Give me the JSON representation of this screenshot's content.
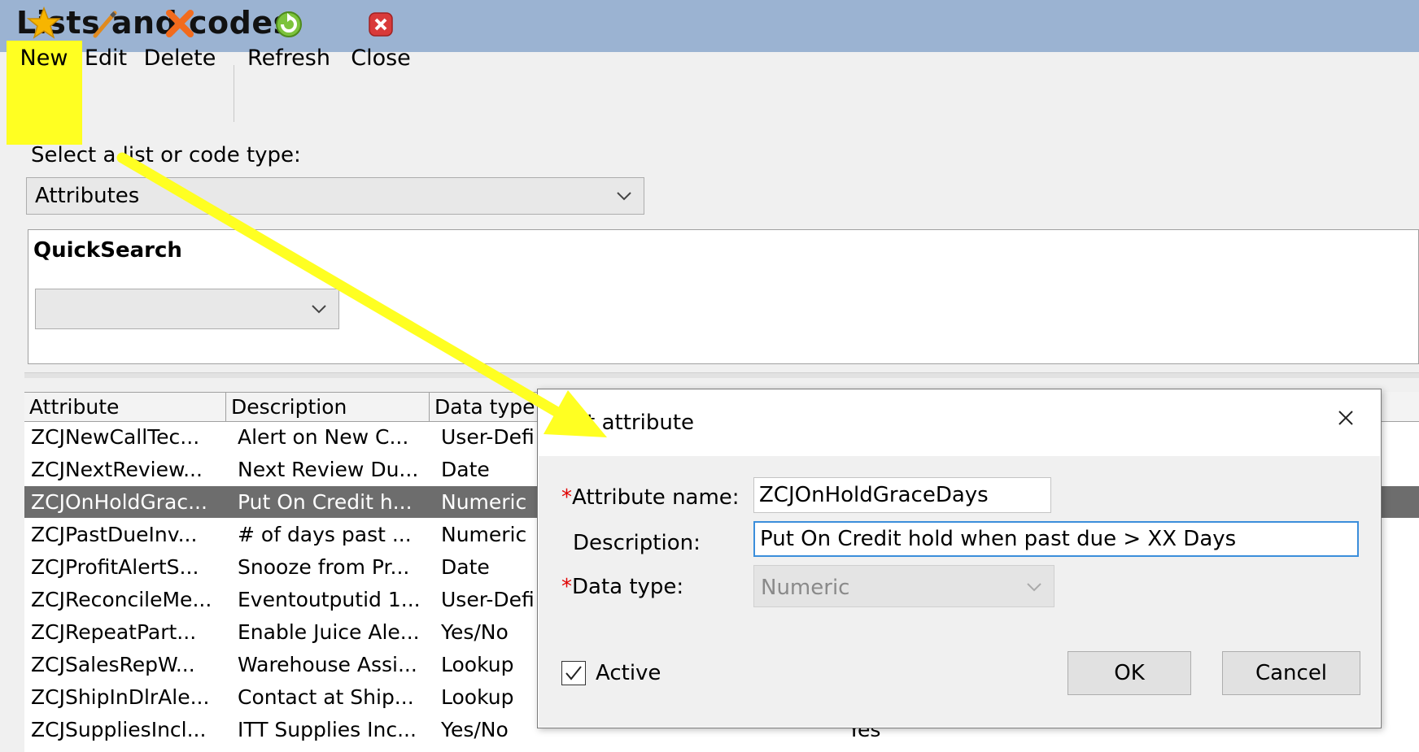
{
  "window": {
    "title": "Lists and codes"
  },
  "toolbar": {
    "new_label": "New",
    "edit_label": "Edit",
    "delete_label": "Delete",
    "refresh_label": "Refresh",
    "close_label": "Close",
    "highlight_color": "#ffff22"
  },
  "selector": {
    "label": "Select a list or code type:",
    "value": "Attributes"
  },
  "quicksearch": {
    "title": "QuickSearch",
    "value": ""
  },
  "grid": {
    "columns": [
      "Attribute",
      "Description",
      "Data type"
    ],
    "rows": [
      {
        "attribute": "ZCJNewCallTec...",
        "description": "Alert on New C...",
        "data_type": "User-Defi",
        "extra": ""
      },
      {
        "attribute": "ZCJNextReview...",
        "description": "Next Review Du...",
        "data_type": "Date",
        "extra": ""
      },
      {
        "attribute": "ZCJOnHoldGrac...",
        "description": "Put On Credit h...",
        "data_type": "Numeric",
        "extra": "",
        "selected": true
      },
      {
        "attribute": "ZCJPastDueInv...",
        "description": "# of days past ...",
        "data_type": "Numeric",
        "extra": ""
      },
      {
        "attribute": "ZCJProfitAlertS...",
        "description": "Snooze from Pr...",
        "data_type": "Date",
        "extra": ""
      },
      {
        "attribute": "ZCJReconcileMe...",
        "description": "Eventoutputid 1...",
        "data_type": "User-Defi",
        "extra": ""
      },
      {
        "attribute": "ZCJRepeatPart...",
        "description": "Enable Juice Ale...",
        "data_type": "Yes/No",
        "extra": ""
      },
      {
        "attribute": "ZCJSalesRepW...",
        "description": "Warehouse Assi...",
        "data_type": "Lookup",
        "extra": ""
      },
      {
        "attribute": "ZCJShipInDlrAle...",
        "description": "Contact at Ship...",
        "data_type": "Lookup",
        "extra": ""
      },
      {
        "attribute": "ZCJSuppliesIncl...",
        "description": "ITT Supplies Inc...",
        "data_type": "Yes/No",
        "extra": "Yes"
      }
    ]
  },
  "dialog": {
    "title": "Edit attribute",
    "attribute_name_label": "Attribute name:",
    "attribute_name_value": "ZCJOnHoldGraceDays",
    "description_label": "Description:",
    "description_value": "Put On Credit hold when past due > XX Days",
    "data_type_label": "Data type:",
    "data_type_value": "Numeric",
    "required_marker": "*",
    "active_label": "Active",
    "active_checked": true,
    "ok_label": "OK",
    "cancel_label": "Cancel"
  },
  "annotation": {
    "arrow_color": "#ffff22"
  },
  "icons": [
    "star-icon",
    "pencil-icon",
    "x-delete-icon",
    "refresh-icon",
    "close-red-icon",
    "chevron-down-icon",
    "close-icon",
    "checkmark-icon"
  ]
}
